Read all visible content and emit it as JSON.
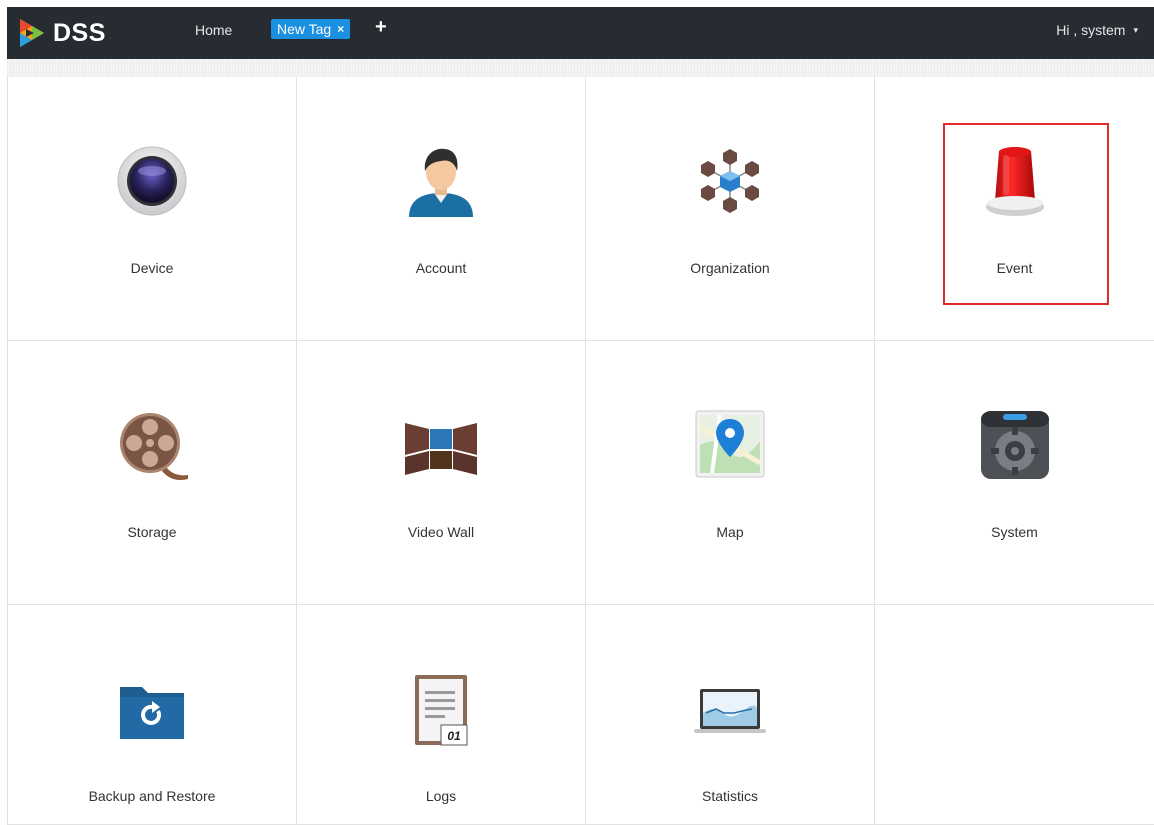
{
  "header": {
    "logo_text": "DSS",
    "home_label": "Home",
    "active_tab": "New Tag",
    "tab_close": "×",
    "add_tab": "+",
    "user_greeting": "Hi , system",
    "user_caret": "▾"
  },
  "tiles": [
    {
      "label": "Device",
      "icon": "camera-lens-icon"
    },
    {
      "label": "Account",
      "icon": "user-avatar-icon"
    },
    {
      "label": "Organization",
      "icon": "cube-network-icon"
    },
    {
      "label": "Event",
      "icon": "alarm-siren-icon"
    },
    {
      "label": "Storage",
      "icon": "film-reel-icon"
    },
    {
      "label": "Video Wall",
      "icon": "video-wall-icon"
    },
    {
      "label": "Map",
      "icon": "map-pin-icon"
    },
    {
      "label": "System",
      "icon": "system-gear-icon"
    },
    {
      "label": "Backup and Restore",
      "icon": "backup-folder-icon"
    },
    {
      "label": "Logs",
      "icon": "logs-calendar-icon"
    },
    {
      "label": "Statistics",
      "icon": "statistics-monitor-icon"
    }
  ],
  "logs_icon_date": "01",
  "colors": {
    "topbar": "#272c33",
    "tab_active": "#1b8fe0",
    "highlight": "#e22b2b"
  }
}
